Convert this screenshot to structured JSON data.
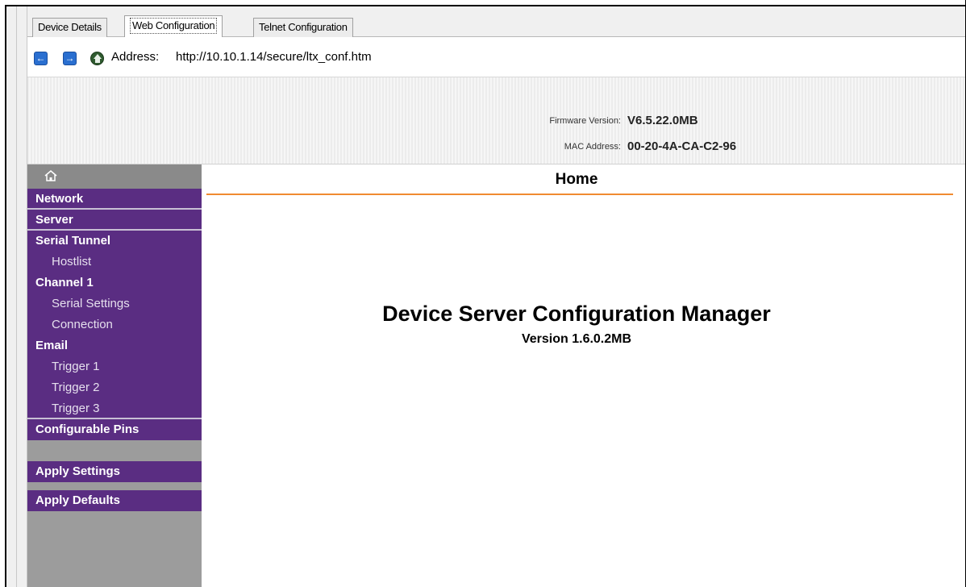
{
  "tabs": [
    {
      "label": "Device Details",
      "active": false
    },
    {
      "label": "Web Configuration",
      "active": true
    },
    {
      "label": "Telnet Configuration",
      "active": false
    }
  ],
  "address_bar": {
    "back_icon": "arrow-left-icon",
    "forward_icon": "arrow-right-icon",
    "home_icon": "home-icon",
    "label": "Address:",
    "url": "http://10.10.1.14/secure/ltx_conf.htm"
  },
  "header": {
    "firmware_label": "Firmware Version:",
    "firmware_value": "V6.5.22.0MB",
    "mac_label": "MAC Address:",
    "mac_value": "00-20-4A-CA-C2-96"
  },
  "sidebar": {
    "home_icon": "home-icon",
    "items": [
      {
        "label": "Network"
      },
      {
        "label": "Server"
      },
      {
        "label": "Serial Tunnel"
      },
      {
        "label": "Hostlist"
      },
      {
        "label": "Channel 1"
      },
      {
        "label": "Serial Settings"
      },
      {
        "label": "Connection"
      },
      {
        "label": "Email"
      },
      {
        "label": "Trigger 1"
      },
      {
        "label": "Trigger 2"
      },
      {
        "label": "Trigger 3"
      },
      {
        "label": "Configurable Pins"
      },
      {
        "label": "Apply Settings"
      },
      {
        "label": "Apply Defaults"
      }
    ]
  },
  "main": {
    "title": "Home",
    "app_name": "Device Server Configuration Manager",
    "app_version": "Version 1.6.0.2MB"
  },
  "colors": {
    "sidebar_purple": "#5a2d82",
    "sidebar_gray": "#9c9c9c",
    "title_rule_orange": "#f08a30"
  }
}
